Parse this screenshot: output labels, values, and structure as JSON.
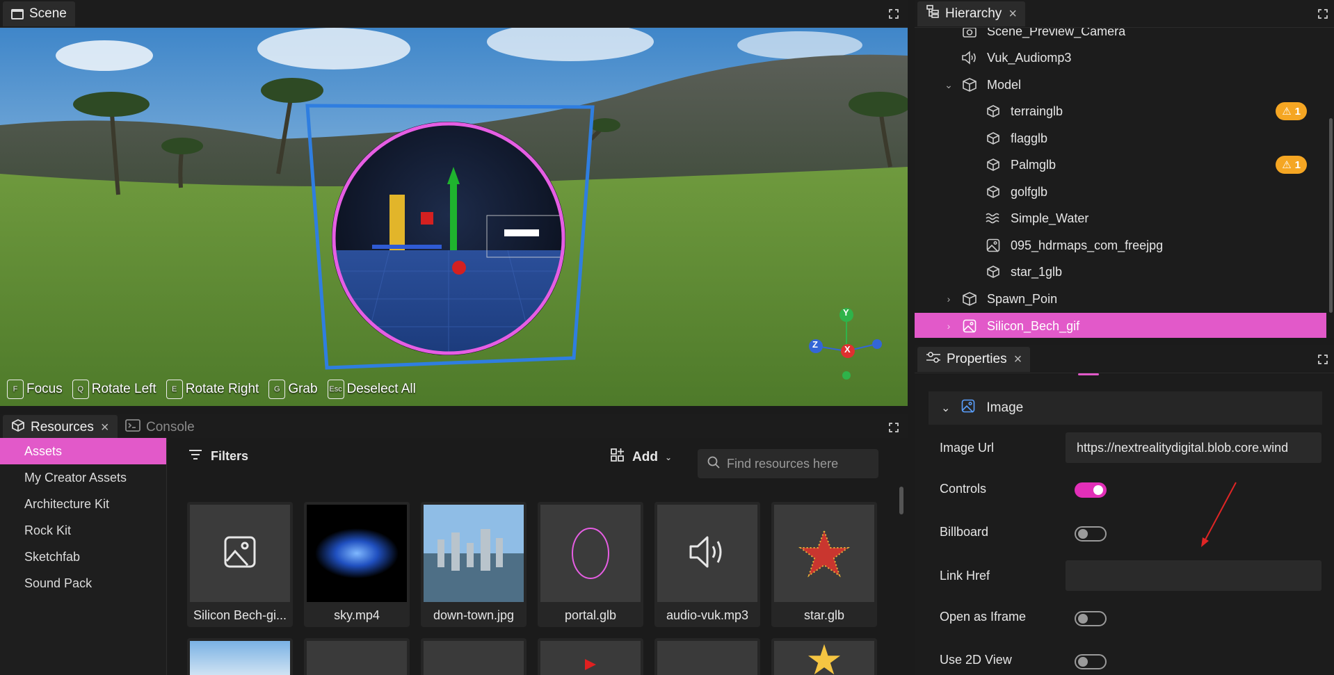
{
  "scene": {
    "tab_label": "Scene",
    "shortcuts": [
      {
        "key": "F",
        "label": "Focus"
      },
      {
        "key": "Q",
        "label": "Rotate Left"
      },
      {
        "key": "E",
        "label": "Rotate Right"
      },
      {
        "key": "G",
        "label": "Grab"
      },
      {
        "key": "Esc",
        "label": "Deselect All"
      }
    ],
    "gizmo": {
      "y": "Y",
      "z": "Z",
      "x": "X"
    }
  },
  "hierarchy": {
    "tab_label": "Hierarchy",
    "items": [
      {
        "label": "Scene_Preview_Camera",
        "icon": "camera-icon",
        "depth": 1
      },
      {
        "label": "Vuk_Audiomp3",
        "icon": "speaker-icon",
        "depth": 1
      },
      {
        "label": "Model",
        "icon": "cubes-icon",
        "depth": 1,
        "expanded": true
      },
      {
        "label": "terrainglb",
        "icon": "cube-icon",
        "depth": 2,
        "warning": "1"
      },
      {
        "label": "flagglb",
        "icon": "cube-icon",
        "depth": 2
      },
      {
        "label": "Palmglb",
        "icon": "cube-icon",
        "depth": 2,
        "warning": "1"
      },
      {
        "label": "golfglb",
        "icon": "cube-icon",
        "depth": 2
      },
      {
        "label": "Simple_Water",
        "icon": "water-icon",
        "depth": 2
      },
      {
        "label": "095_hdrmaps_com_freejpg",
        "icon": "image-icon",
        "depth": 2
      },
      {
        "label": "star_1glb",
        "icon": "cube-icon",
        "depth": 2
      },
      {
        "label": "Spawn_Poin",
        "icon": "cubes-icon",
        "depth": 1,
        "collapsed": true
      },
      {
        "label": "Silicon_Bech_gif",
        "icon": "image-icon",
        "depth": 1,
        "collapsed": true,
        "selected": true
      }
    ]
  },
  "properties": {
    "tab_label": "Properties",
    "section_title": "Image",
    "image_url_label": "Image Url",
    "image_url_value": "https://nextrealitydigital.blob.core.wind",
    "controls_label": "Controls",
    "controls_on": true,
    "billboard_label": "Billboard",
    "billboard_on": false,
    "link_href_label": "Link Href",
    "link_href_value": "",
    "iframe_label": "Open as Iframe",
    "iframe_on": false,
    "view2d_label": "Use 2D View",
    "view2d_on": false
  },
  "resources": {
    "tab_label": "Resources",
    "console_label": "Console",
    "sidebar": [
      "Assets",
      "My Creator Assets",
      "Architecture Kit",
      "Rock Kit",
      "Sketchfab",
      "Sound Pack"
    ],
    "active_index": 0,
    "filters_label": "Filters",
    "add_label": "Add",
    "search_placeholder": "Find resources here",
    "assets": [
      {
        "label": "Silicon Bech-gi...",
        "thumb": "image-icon"
      },
      {
        "label": "sky.mp4",
        "thumb": "nebula"
      },
      {
        "label": "down-town.jpg",
        "thumb": "city"
      },
      {
        "label": "portal.glb",
        "thumb": "ring"
      },
      {
        "label": "audio-vuk.mp3",
        "thumb": "speaker-icon"
      },
      {
        "label": "star.glb",
        "thumb": "star"
      }
    ]
  },
  "colors": {
    "accent": "#e259c9",
    "warning": "#f5a623"
  }
}
